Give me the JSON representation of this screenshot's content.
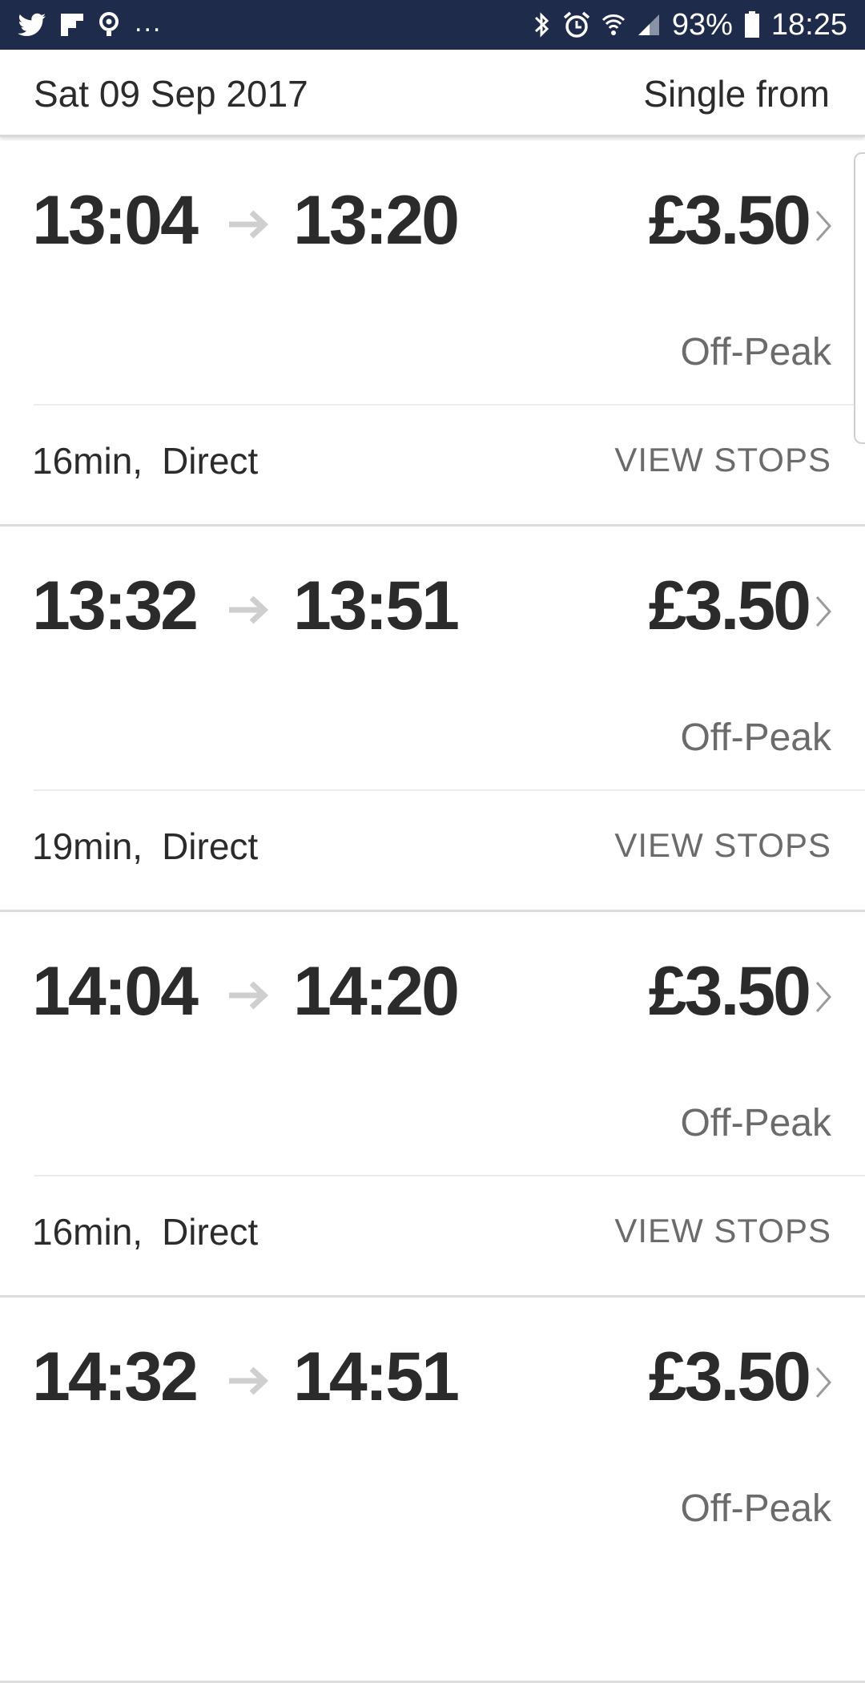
{
  "status_bar": {
    "dots": "...",
    "battery": "93%",
    "time": "18:25",
    "icons": [
      "twitter-icon",
      "flipboard-icon",
      "location-pin-icon",
      "bluetooth-icon",
      "alarm-icon",
      "wifi-icon",
      "signal-icon",
      "battery-icon"
    ],
    "background": "#1e2b4a"
  },
  "header": {
    "date": "Sat 09 Sep 2017",
    "single_from": "Single from"
  },
  "journeys": [
    {
      "depart": "13:04",
      "arrive": "13:20",
      "price": "£3.50",
      "fare_type": "Off-Peak",
      "duration": "16min,",
      "type": "Direct",
      "view_stops": "VIEW STOPS"
    },
    {
      "depart": "13:32",
      "arrive": "13:51",
      "price": "£3.50",
      "fare_type": "Off-Peak",
      "duration": "19min,",
      "type": "Direct",
      "view_stops": "VIEW STOPS"
    },
    {
      "depart": "14:04",
      "arrive": "14:20",
      "price": "£3.50",
      "fare_type": "Off-Peak",
      "duration": "16min,",
      "type": "Direct",
      "view_stops": "VIEW STOPS"
    },
    {
      "depart": "14:32",
      "arrive": "14:51",
      "price": "£3.50",
      "fare_type": "Off-Peak",
      "duration": "",
      "type": "",
      "view_stops": ""
    }
  ]
}
